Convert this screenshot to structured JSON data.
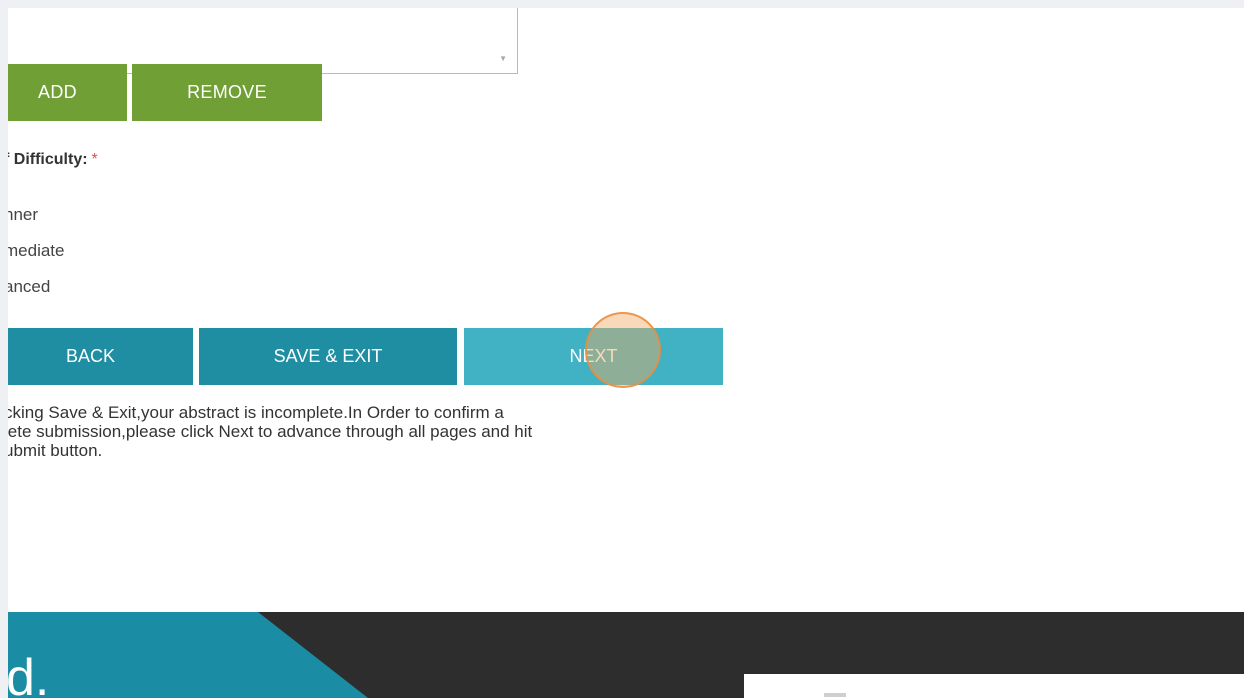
{
  "form": {
    "add_label": "ADD",
    "remove_label": "REMOVE",
    "difficulty": {
      "label": "f Difficulty:",
      "required_mark": "*",
      "options": [
        "nner",
        "mediate",
        "anced"
      ]
    },
    "nav": {
      "back_label": "BACK",
      "save_exit_label": "SAVE & EXIT",
      "next_label": "NEXT"
    },
    "notice_lines": [
      "cking Save & Exit,your abstract is incomplete.In Order to confirm a",
      "lete submission,please click Next to advance through all pages and hit",
      "ubmit button."
    ]
  },
  "footer": {
    "logo_text": "d."
  },
  "colors": {
    "green_button": "#6f9f35",
    "teal_button": "#1f8ea3",
    "next_button": "#41b1c4",
    "footer_dark": "#2d2d2d",
    "footer_teal": "#1a8ca3",
    "required": "#d9534f",
    "click_highlight": "#eb8c3c"
  }
}
